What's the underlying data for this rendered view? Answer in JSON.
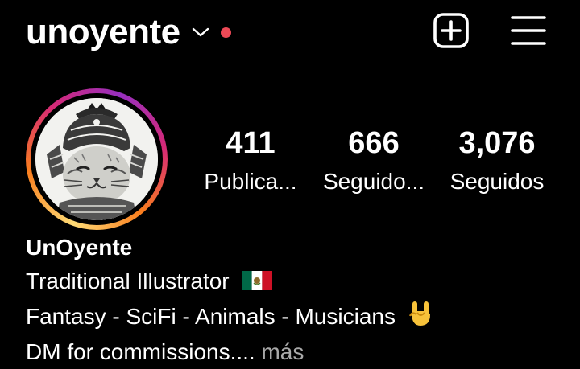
{
  "header": {
    "username": "unoyente",
    "notification_color": "#ed4956",
    "icons": {
      "switcher": "chevron-down-icon",
      "new_post": "plus-square-icon",
      "menu": "hamburger-menu-icon"
    }
  },
  "profile": {
    "avatar_icon": "samurai-cat-illustration",
    "stats": {
      "posts": {
        "count": "411",
        "label": "Publica..."
      },
      "followers": {
        "count": "666",
        "label": "Seguido..."
      },
      "following": {
        "count": "3,076",
        "label": "Seguidos"
      }
    }
  },
  "bio": {
    "name": "UnOyente",
    "line1": "Traditional Illustrator",
    "line1_emoji": "mexico-flag-emoji",
    "line2": "Fantasy - SciFi - Animals - Musicians",
    "line2_emoji": "rock-hand-emoji",
    "line3": "DM for commissions.... ",
    "more_label": "más"
  },
  "colors": {
    "background": "#000000",
    "text": "#ffffff",
    "secondary_text": "#a8a8a8",
    "story_ring": [
      "#feda75",
      "#fa7e1e",
      "#d62976",
      "#962fbf"
    ]
  }
}
